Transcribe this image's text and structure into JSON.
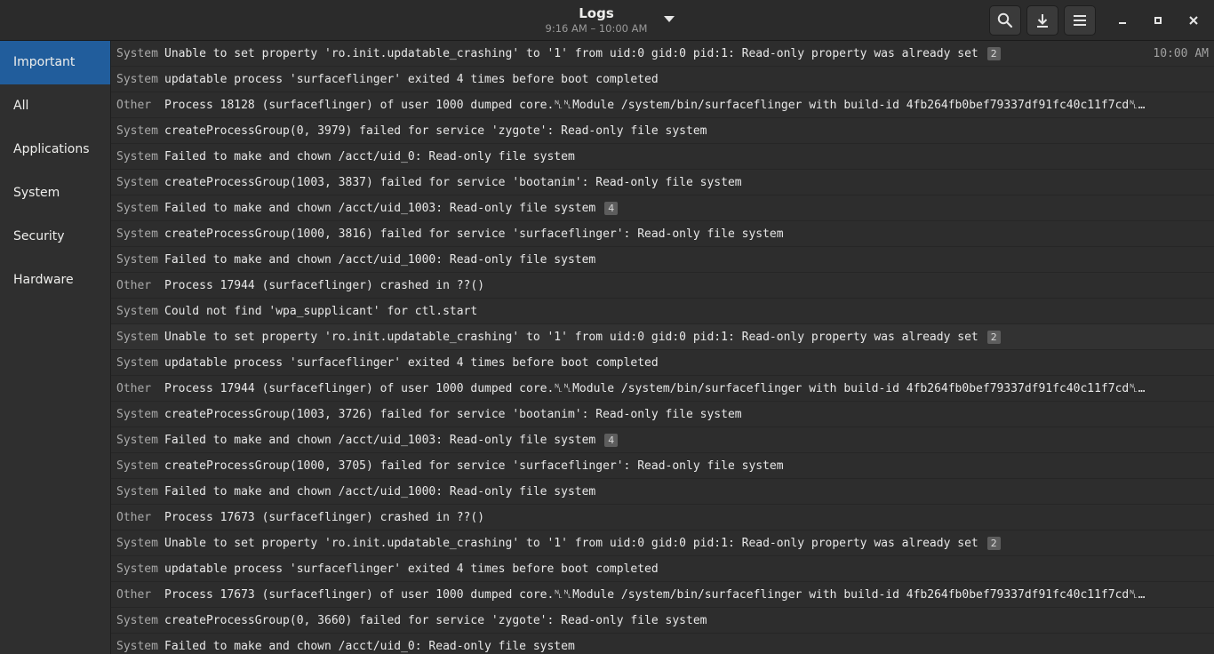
{
  "header": {
    "title": "Logs",
    "subtitle": "9:16 AM – 10:00 AM",
    "search_icon": "search-icon",
    "export_icon": "download-icon",
    "menu_icon": "hamburger-menu-icon"
  },
  "sidebar": {
    "items": [
      {
        "label": "Important",
        "active": true
      },
      {
        "label": "All"
      },
      {
        "label": "Applications"
      },
      {
        "label": "System"
      },
      {
        "label": "Security"
      },
      {
        "label": "Hardware"
      }
    ]
  },
  "rows": [
    {
      "cat": "System",
      "msg": "Unable to set property 'ro.init.updatable_crashing' to '1' from uid:0 gid:0 pid:1: Read-only property was already set",
      "badge": "2",
      "time": "10:00 AM"
    },
    {
      "cat": "System",
      "msg": "updatable process 'surfaceflinger' exited 4 times before boot completed",
      "badge": "",
      "time": ""
    },
    {
      "cat": "Other",
      "msg": "Process 18128 (surfaceflinger) of user 1000 dumped core.␤␤Module /system/bin/surfaceflinger with build-id 4fb264fb0bef79337df91fc40c11f7cd␤…",
      "badge": "",
      "time": ""
    },
    {
      "cat": "System",
      "msg": "createProcessGroup(0, 3979) failed for service 'zygote': Read-only file system",
      "badge": "",
      "time": ""
    },
    {
      "cat": "System",
      "msg": "Failed to make and chown /acct/uid_0: Read-only file system",
      "badge": "",
      "time": ""
    },
    {
      "cat": "System",
      "msg": "createProcessGroup(1003, 3837) failed for service 'bootanim': Read-only file system",
      "badge": "",
      "time": ""
    },
    {
      "cat": "System",
      "msg": "Failed to make and chown /acct/uid_1003: Read-only file system",
      "badge": "4",
      "time": ""
    },
    {
      "cat": "System",
      "msg": "createProcessGroup(1000, 3816) failed for service 'surfaceflinger': Read-only file system",
      "badge": "",
      "time": ""
    },
    {
      "cat": "System",
      "msg": "Failed to make and chown /acct/uid_1000: Read-only file system",
      "badge": "",
      "time": ""
    },
    {
      "cat": "Other",
      "msg": "Process 17944 (surfaceflinger) crashed in ??()",
      "badge": "",
      "time": ""
    },
    {
      "cat": "System",
      "msg": "Could not find 'wpa_supplicant' for ctl.start",
      "badge": "",
      "time": ""
    },
    {
      "cat": "System",
      "msg": "Unable to set property 'ro.init.updatable_crashing' to '1' from uid:0 gid:0 pid:1: Read-only property was already set",
      "badge": "2",
      "time": "",
      "hl": true
    },
    {
      "cat": "System",
      "msg": "updatable process 'surfaceflinger' exited 4 times before boot completed",
      "badge": "",
      "time": ""
    },
    {
      "cat": "Other",
      "msg": "Process 17944 (surfaceflinger) of user 1000 dumped core.␤␤Module /system/bin/surfaceflinger with build-id 4fb264fb0bef79337df91fc40c11f7cd␤…",
      "badge": "",
      "time": ""
    },
    {
      "cat": "System",
      "msg": "createProcessGroup(1003, 3726) failed for service 'bootanim': Read-only file system",
      "badge": "",
      "time": ""
    },
    {
      "cat": "System",
      "msg": "Failed to make and chown /acct/uid_1003: Read-only file system",
      "badge": "4",
      "time": ""
    },
    {
      "cat": "System",
      "msg": "createProcessGroup(1000, 3705) failed for service 'surfaceflinger': Read-only file system",
      "badge": "",
      "time": ""
    },
    {
      "cat": "System",
      "msg": "Failed to make and chown /acct/uid_1000: Read-only file system",
      "badge": "",
      "time": ""
    },
    {
      "cat": "Other",
      "msg": "Process 17673 (surfaceflinger) crashed in ??()",
      "badge": "",
      "time": ""
    },
    {
      "cat": "System",
      "msg": "Unable to set property 'ro.init.updatable_crashing' to '1' from uid:0 gid:0 pid:1: Read-only property was already set",
      "badge": "2",
      "time": ""
    },
    {
      "cat": "System",
      "msg": "updatable process 'surfaceflinger' exited 4 times before boot completed",
      "badge": "",
      "time": ""
    },
    {
      "cat": "Other",
      "msg": "Process 17673 (surfaceflinger) of user 1000 dumped core.␤␤Module /system/bin/surfaceflinger with build-id 4fb264fb0bef79337df91fc40c11f7cd␤…",
      "badge": "",
      "time": ""
    },
    {
      "cat": "System",
      "msg": "createProcessGroup(0, 3660) failed for service 'zygote': Read-only file system",
      "badge": "",
      "time": ""
    },
    {
      "cat": "System",
      "msg": "Failed to make and chown /acct/uid_0: Read-only file system",
      "badge": "",
      "time": ""
    }
  ]
}
